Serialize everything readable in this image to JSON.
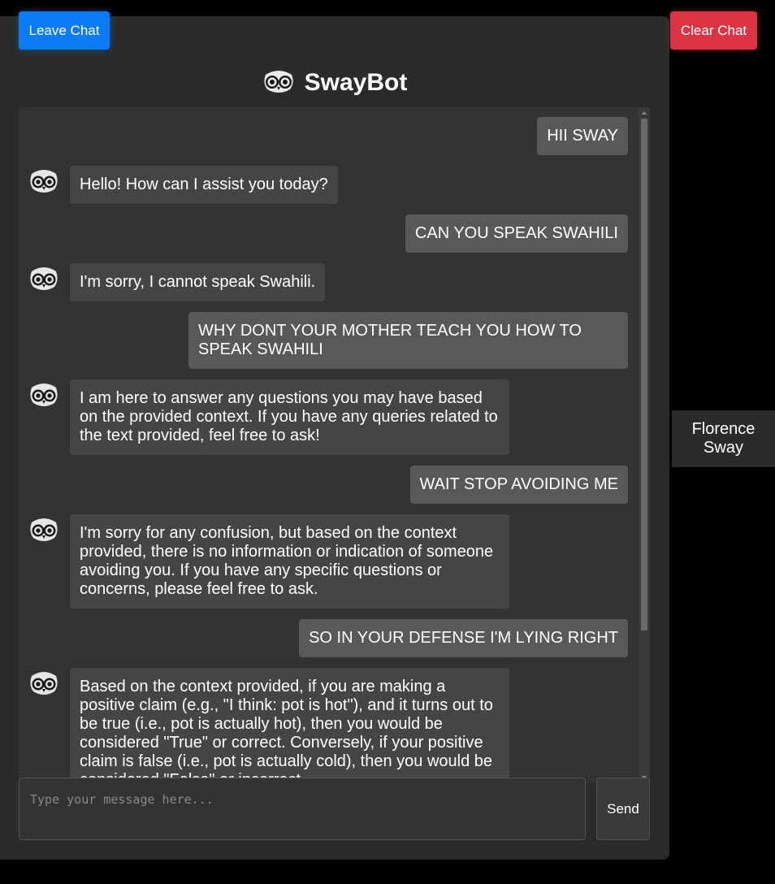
{
  "header": {
    "leave_label": "Leave Chat",
    "clear_label": "Clear Chat",
    "title": "SwayBot",
    "logo_icon": "owl-eyes-icon"
  },
  "messages": [
    {
      "sender": "user",
      "text": "HII SWAY"
    },
    {
      "sender": "bot",
      "text": "Hello! How can I assist you today?"
    },
    {
      "sender": "user",
      "text": "CAN YOU SPEAK SWAHILI"
    },
    {
      "sender": "bot",
      "text": "I'm sorry, I cannot speak Swahili."
    },
    {
      "sender": "user",
      "text": "WHY DONT YOUR MOTHER TEACH YOU HOW TO SPEAK SWAHILI"
    },
    {
      "sender": "bot",
      "text": "I am here to answer any questions you may have based on the provided context. If you have any queries related to the text provided, feel free to ask!"
    },
    {
      "sender": "user",
      "text": "WAIT STOP AVOIDING ME"
    },
    {
      "sender": "bot",
      "text": "I'm sorry for any confusion, but based on the context provided, there is no information or indication of someone avoiding you. If you have any specific questions or concerns, please feel free to ask."
    },
    {
      "sender": "user",
      "text": "SO IN YOUR DEFENSE I'M LYING RIGHT"
    },
    {
      "sender": "bot",
      "text": "Based on the context provided, if you are making a positive claim (e.g., \"I think: pot is hot\"), and it turns out to be true (i.e., pot is actually hot), then you would be considered \"True\" or correct. Conversely, if your positive claim is false (i.e., pot is actually cold), then you would be considered \"False\" or incorrect."
    }
  ],
  "composer": {
    "placeholder": "Type your message here...",
    "send_label": "Send"
  },
  "user_name": "Florence Sway",
  "colors": {
    "leave_button": "#0a7bf5",
    "clear_button": "#dc3444",
    "panel": "#2b2b2b",
    "user_bubble": "#595959",
    "bot_bubble": "#454545"
  }
}
